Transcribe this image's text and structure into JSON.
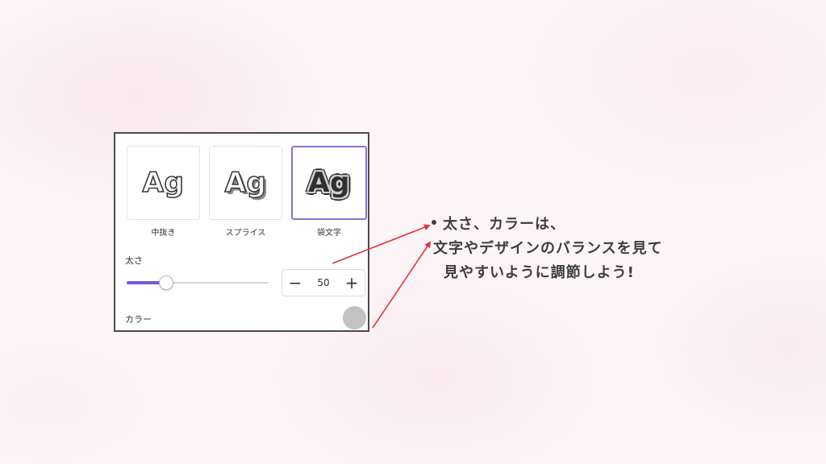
{
  "panel": {
    "styles": [
      {
        "preview": "Ag",
        "label": "中抜き",
        "selected": false
      },
      {
        "preview": "Ag",
        "label": "スプライス",
        "selected": false
      },
      {
        "preview": "Ag",
        "label": "袋文字",
        "selected": true
      }
    ],
    "thickness": {
      "label": "太さ",
      "value": "50",
      "slider_fraction": 0.28,
      "minus_symbol": "−",
      "plus_symbol": "+"
    },
    "color": {
      "label": "カラー",
      "swatch": "#c2c2c2"
    }
  },
  "annotation": {
    "line1": "太さ、カラーは、",
    "line2": "文字やデザインのバランスを見て",
    "line3": "見やすいように調節しよう!",
    "arrow_color": "#e8323c",
    "accent": "#7b55d4"
  }
}
